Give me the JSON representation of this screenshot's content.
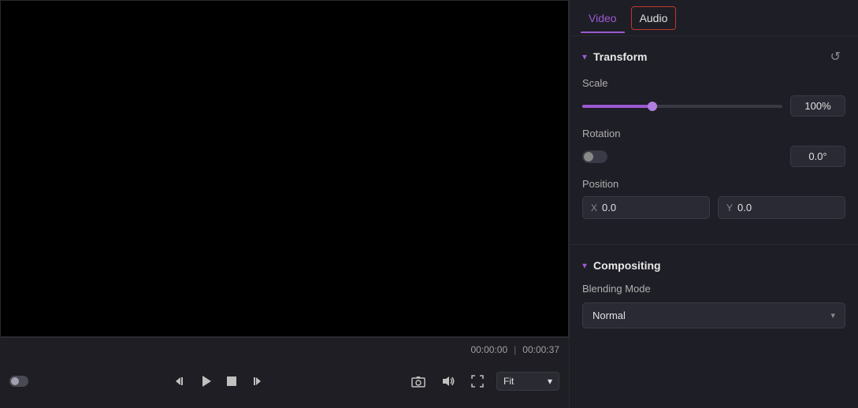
{
  "tabs": {
    "video": {
      "label": "Video",
      "active": true
    },
    "audio": {
      "label": "Audio",
      "highlighted": true
    }
  },
  "transform": {
    "section_title": "Transform",
    "reset_icon": "↺",
    "scale": {
      "label": "Scale",
      "slider_fill_pct": 35,
      "slider_thumb_pct": 35,
      "value": "100%"
    },
    "rotation": {
      "label": "Rotation",
      "value": "0.0°"
    },
    "position": {
      "label": "Position",
      "x_label": "X",
      "x_value": "0.0",
      "y_label": "Y",
      "y_value": "0.0"
    }
  },
  "compositing": {
    "section_title": "Compositing",
    "blending_mode": {
      "label": "Blending Mode",
      "value": "Normal"
    }
  },
  "video_controls": {
    "current_time": "00:00:00",
    "separator": "|",
    "total_time": "00:00:37",
    "fit_label": "Fit"
  }
}
